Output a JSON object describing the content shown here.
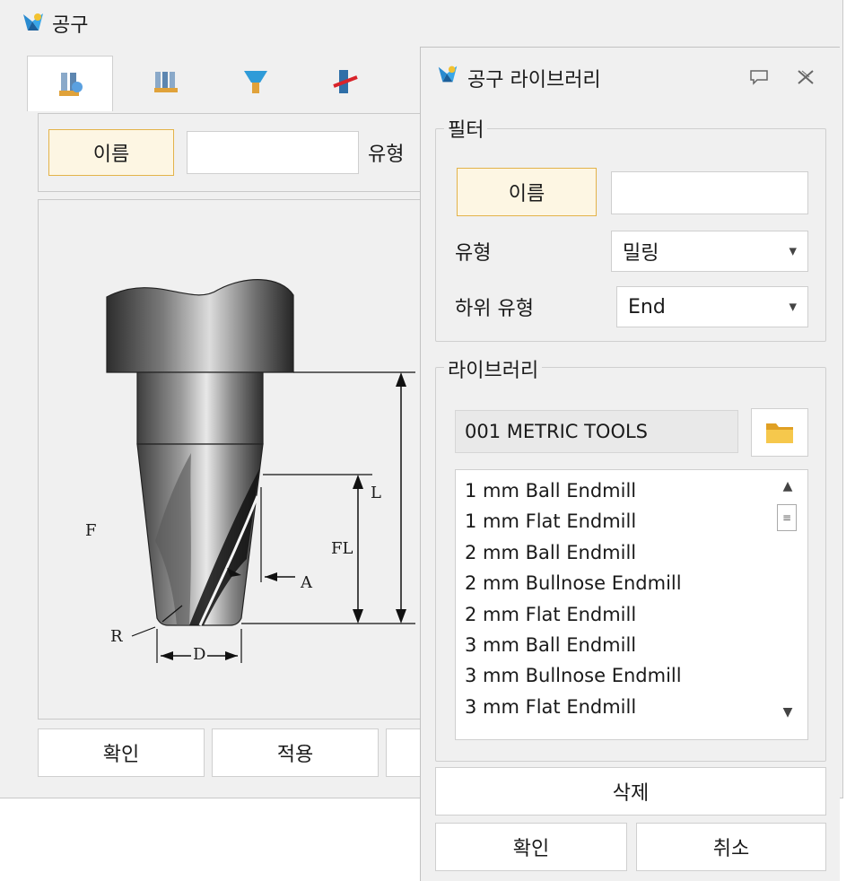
{
  "back_window": {
    "title": "공구",
    "tabs": [
      "tool-info-icon",
      "tool-group-icon",
      "holder-icon",
      "tool-path-icon"
    ],
    "name_button": "이름",
    "type_label": "유형",
    "diagram": {
      "labels": {
        "L": "L",
        "FL": "FL",
        "F": "F",
        "A": "A",
        "R": "R",
        "D": "D"
      }
    },
    "ok_button": "확인",
    "apply_button": "적용"
  },
  "library_window": {
    "title": "공구 라이브러리",
    "filter": {
      "group_title": "필터",
      "name_button": "이름",
      "name_value": "",
      "type_label": "유형",
      "type_value": "밀링",
      "subtype_label": "하위 유형",
      "subtype_value": "End"
    },
    "library": {
      "group_title": "라이브러리",
      "path": "001 METRIC TOOLS",
      "items": [
        "1 mm Ball Endmill",
        "1 mm Flat Endmill",
        "2 mm Ball Endmill",
        "2 mm Bullnose Endmill",
        "2 mm Flat Endmill",
        "3 mm Ball Endmill",
        "3 mm Bullnose Endmill",
        "3 mm Flat Endmill"
      ]
    },
    "delete_button": "삭제",
    "ok_button": "확인",
    "cancel_button": "취소"
  }
}
